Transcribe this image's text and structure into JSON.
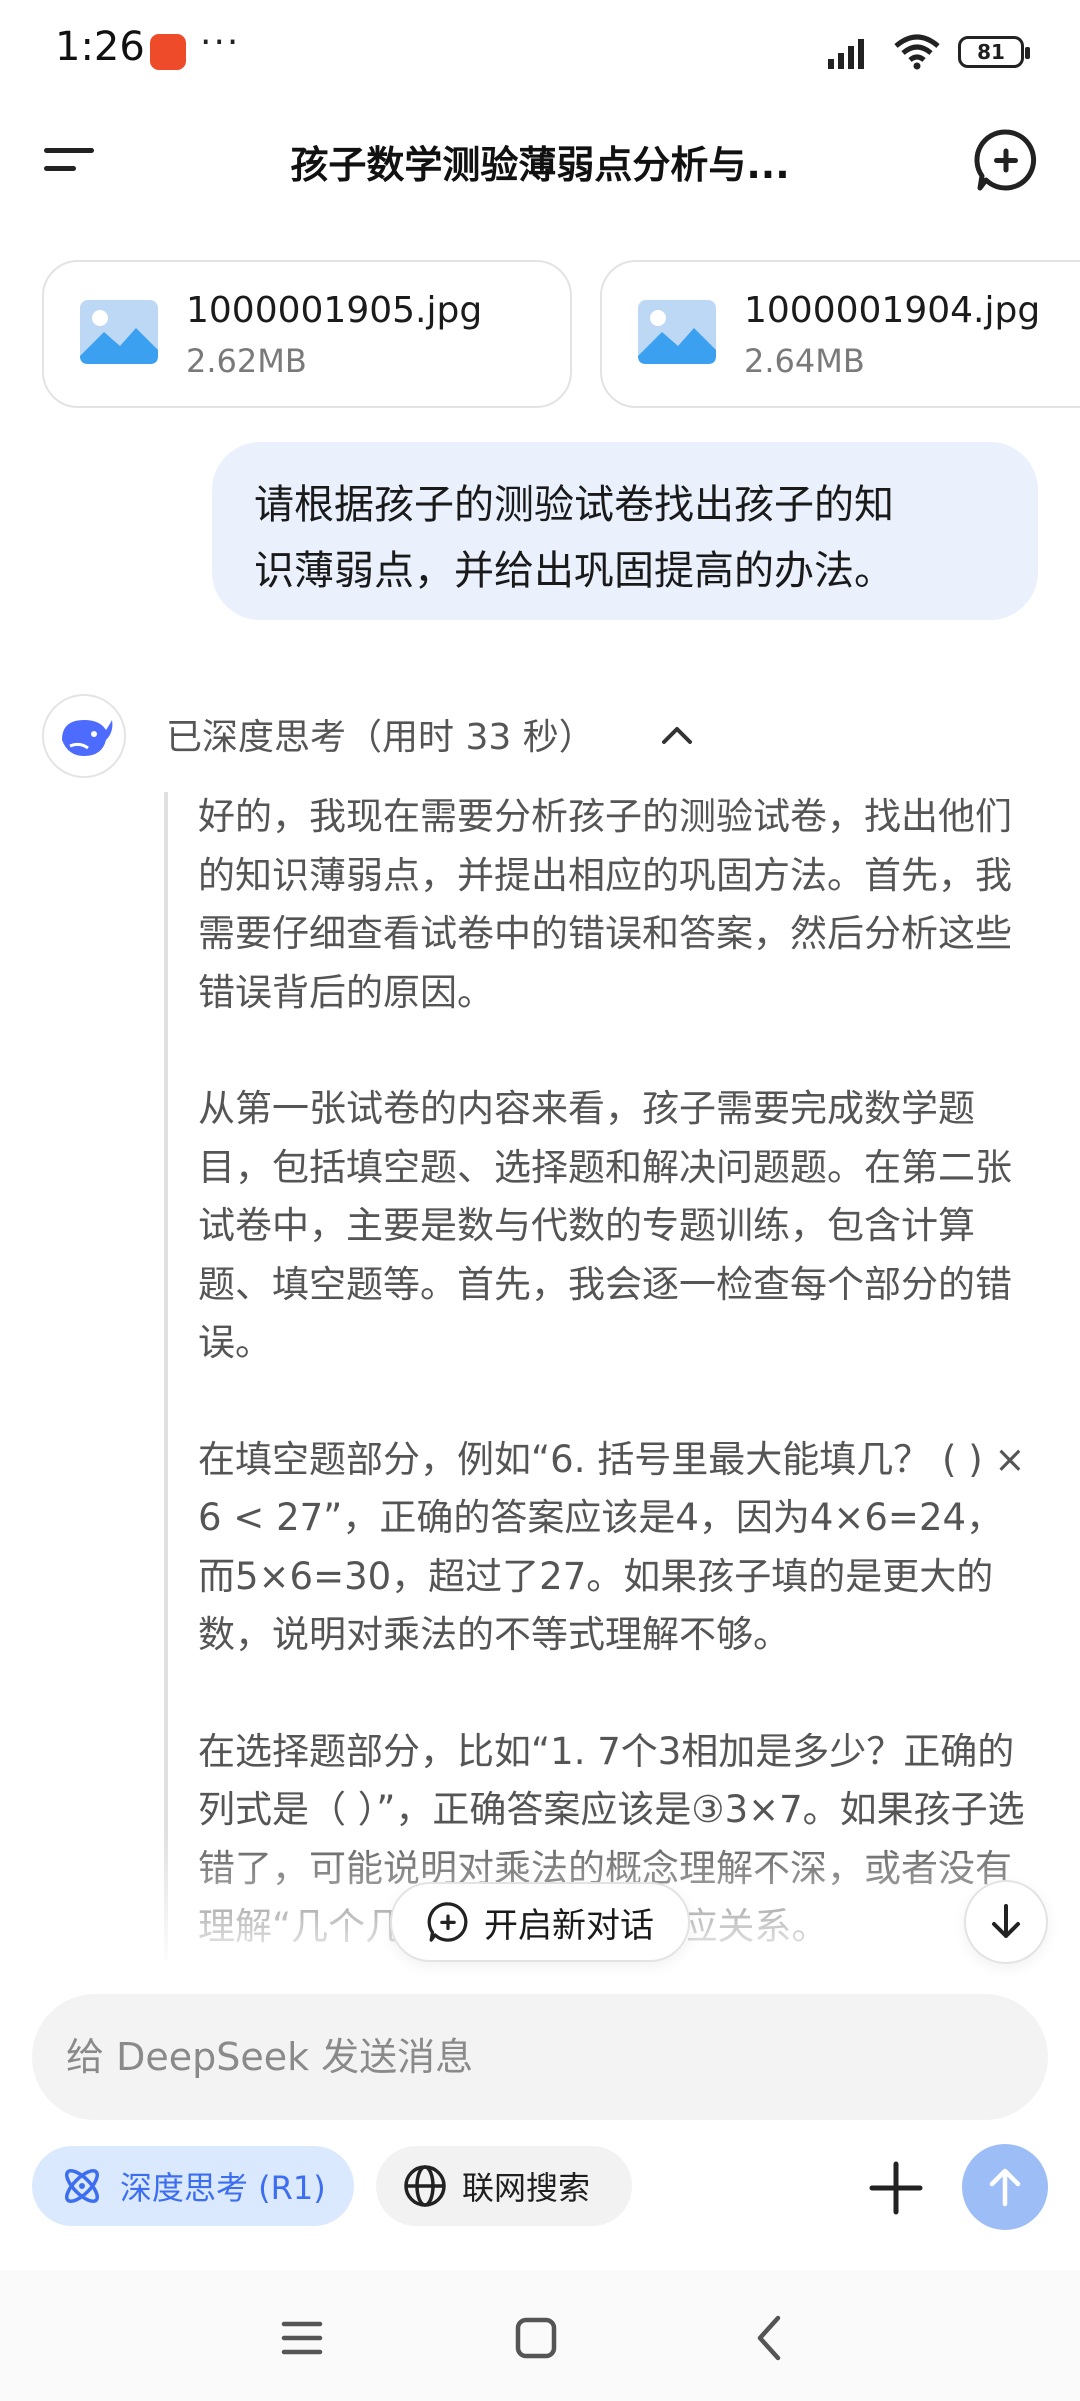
{
  "status_bar": {
    "time": "1:26",
    "dots": "···",
    "battery": "81"
  },
  "header": {
    "title": "孩子数学测验薄弱点分析与..."
  },
  "attachments": [
    {
      "name": "1000001905.jpg",
      "size": "2.62MB"
    },
    {
      "name": "1000001904.jpg",
      "size": "2.64MB"
    }
  ],
  "user_message": {
    "line1": "请根据孩子的测验试卷找出孩子的知",
    "line2": "识薄弱点，并给出巩固提高的办法。"
  },
  "assistant": {
    "think_status": "已深度思考（用时 33 秒）",
    "paragraphs": [
      "好的，我现在需要分析孩子的测验试卷，找出他们的知识薄弱点，并提出相应的巩固方法。首先，我需要仔细查看试卷中的错误和答案，然后分析这些错误背后的原因。",
      "从第一张试卷的内容来看，孩子需要完成数学题目，包括填空题、选择题和解决问题题。在第二张试卷中，主要是数与代数的专题训练，包含计算题、填空题等。首先，我会逐一检查每个部分的错误。",
      "在填空题部分，例如“6. 括号里最大能填几？ ( ) × 6 < 27”，正确的答案应该是4，因为4×6=24，而5×6=30，超过了27。如果孩子填的是更大的数，说明对乘法的不等式理解不够。",
      "在选择题部分，比如“1. 7个3相加是多少？正确的列式是（ ）”，正确答案应该是③3×7。如果孩子选错了，可能说明对乘法的概念理解不深，或者没有理解“几个几相加”与乘法的对应关系。"
    ]
  },
  "floating": {
    "new_chat": "开启新对话"
  },
  "composer": {
    "placeholder": "给 DeepSeek 发送消息",
    "deep_think": "深度思考 (R1)",
    "web_search": "联网搜索"
  },
  "colors": {
    "accent": "#4d6bfe",
    "bubble": "#eaf1fd",
    "send": "#9dbdf6"
  }
}
